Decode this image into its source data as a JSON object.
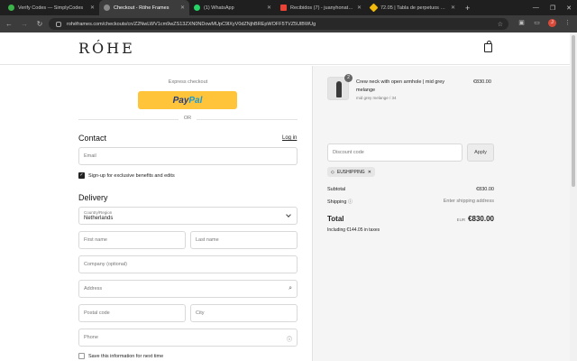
{
  "browser": {
    "tabs": [
      {
        "title": "Verify Codes — SimplyCodes",
        "color": "#3bb54a"
      },
      {
        "title": "Checkout - Róhe Frames",
        "color": "#888888",
        "active": true
      },
      {
        "title": "(1) WhatsApp",
        "color": "#25d366"
      },
      {
        "title": "Recibidos (7) - juanyhonatan7...",
        "color": "#ea4335"
      },
      {
        "title": "72.05 | Tabla de perpetuos de l...",
        "color": "#f0b90b"
      }
    ],
    "url": "rohéframes.com/checkouts/cn/Z2NwLWV1cm9wZS13ZXN0NDowMUpC9lXyV0dZNjhBREpWOFF5TVZ5UlBWUg"
  },
  "store": {
    "logo": "RÓHE"
  },
  "checkout": {
    "express_label": "Express checkout",
    "paypal_1": "Pay",
    "paypal_2": "Pal",
    "or_label": "OR",
    "contact_heading": "Contact",
    "login_link": "Log in",
    "email_placeholder": "Email",
    "signup_label": "Sign-up for exclusive benefits and edits",
    "delivery_heading": "Delivery",
    "country_label": "Country/Region",
    "country_value": "Netherlands",
    "first_name_placeholder": "First name",
    "last_name_placeholder": "Last name",
    "company_placeholder": "Company (optional)",
    "address_placeholder": "Address",
    "postal_placeholder": "Postal code",
    "city_placeholder": "City",
    "phone_placeholder": "Phone",
    "save_label": "Save this information for next time"
  },
  "summary": {
    "qty": "2",
    "product_name": "Crew neck with open armhole | mid grey melange",
    "product_variant": "mid grey melange / 34",
    "product_price": "€830.00",
    "discount_placeholder": "Discount code",
    "apply_label": "Apply",
    "discount_tag": "EUSHIPPING",
    "subtotal_label": "Subtotal",
    "subtotal_value": "€830.00",
    "shipping_label": "Shipping",
    "shipping_value": "Enter shipping address",
    "total_label": "Total",
    "currency": "EUR",
    "total_value": "€830.00",
    "taxes_note": "Including €144.05 in taxes"
  }
}
